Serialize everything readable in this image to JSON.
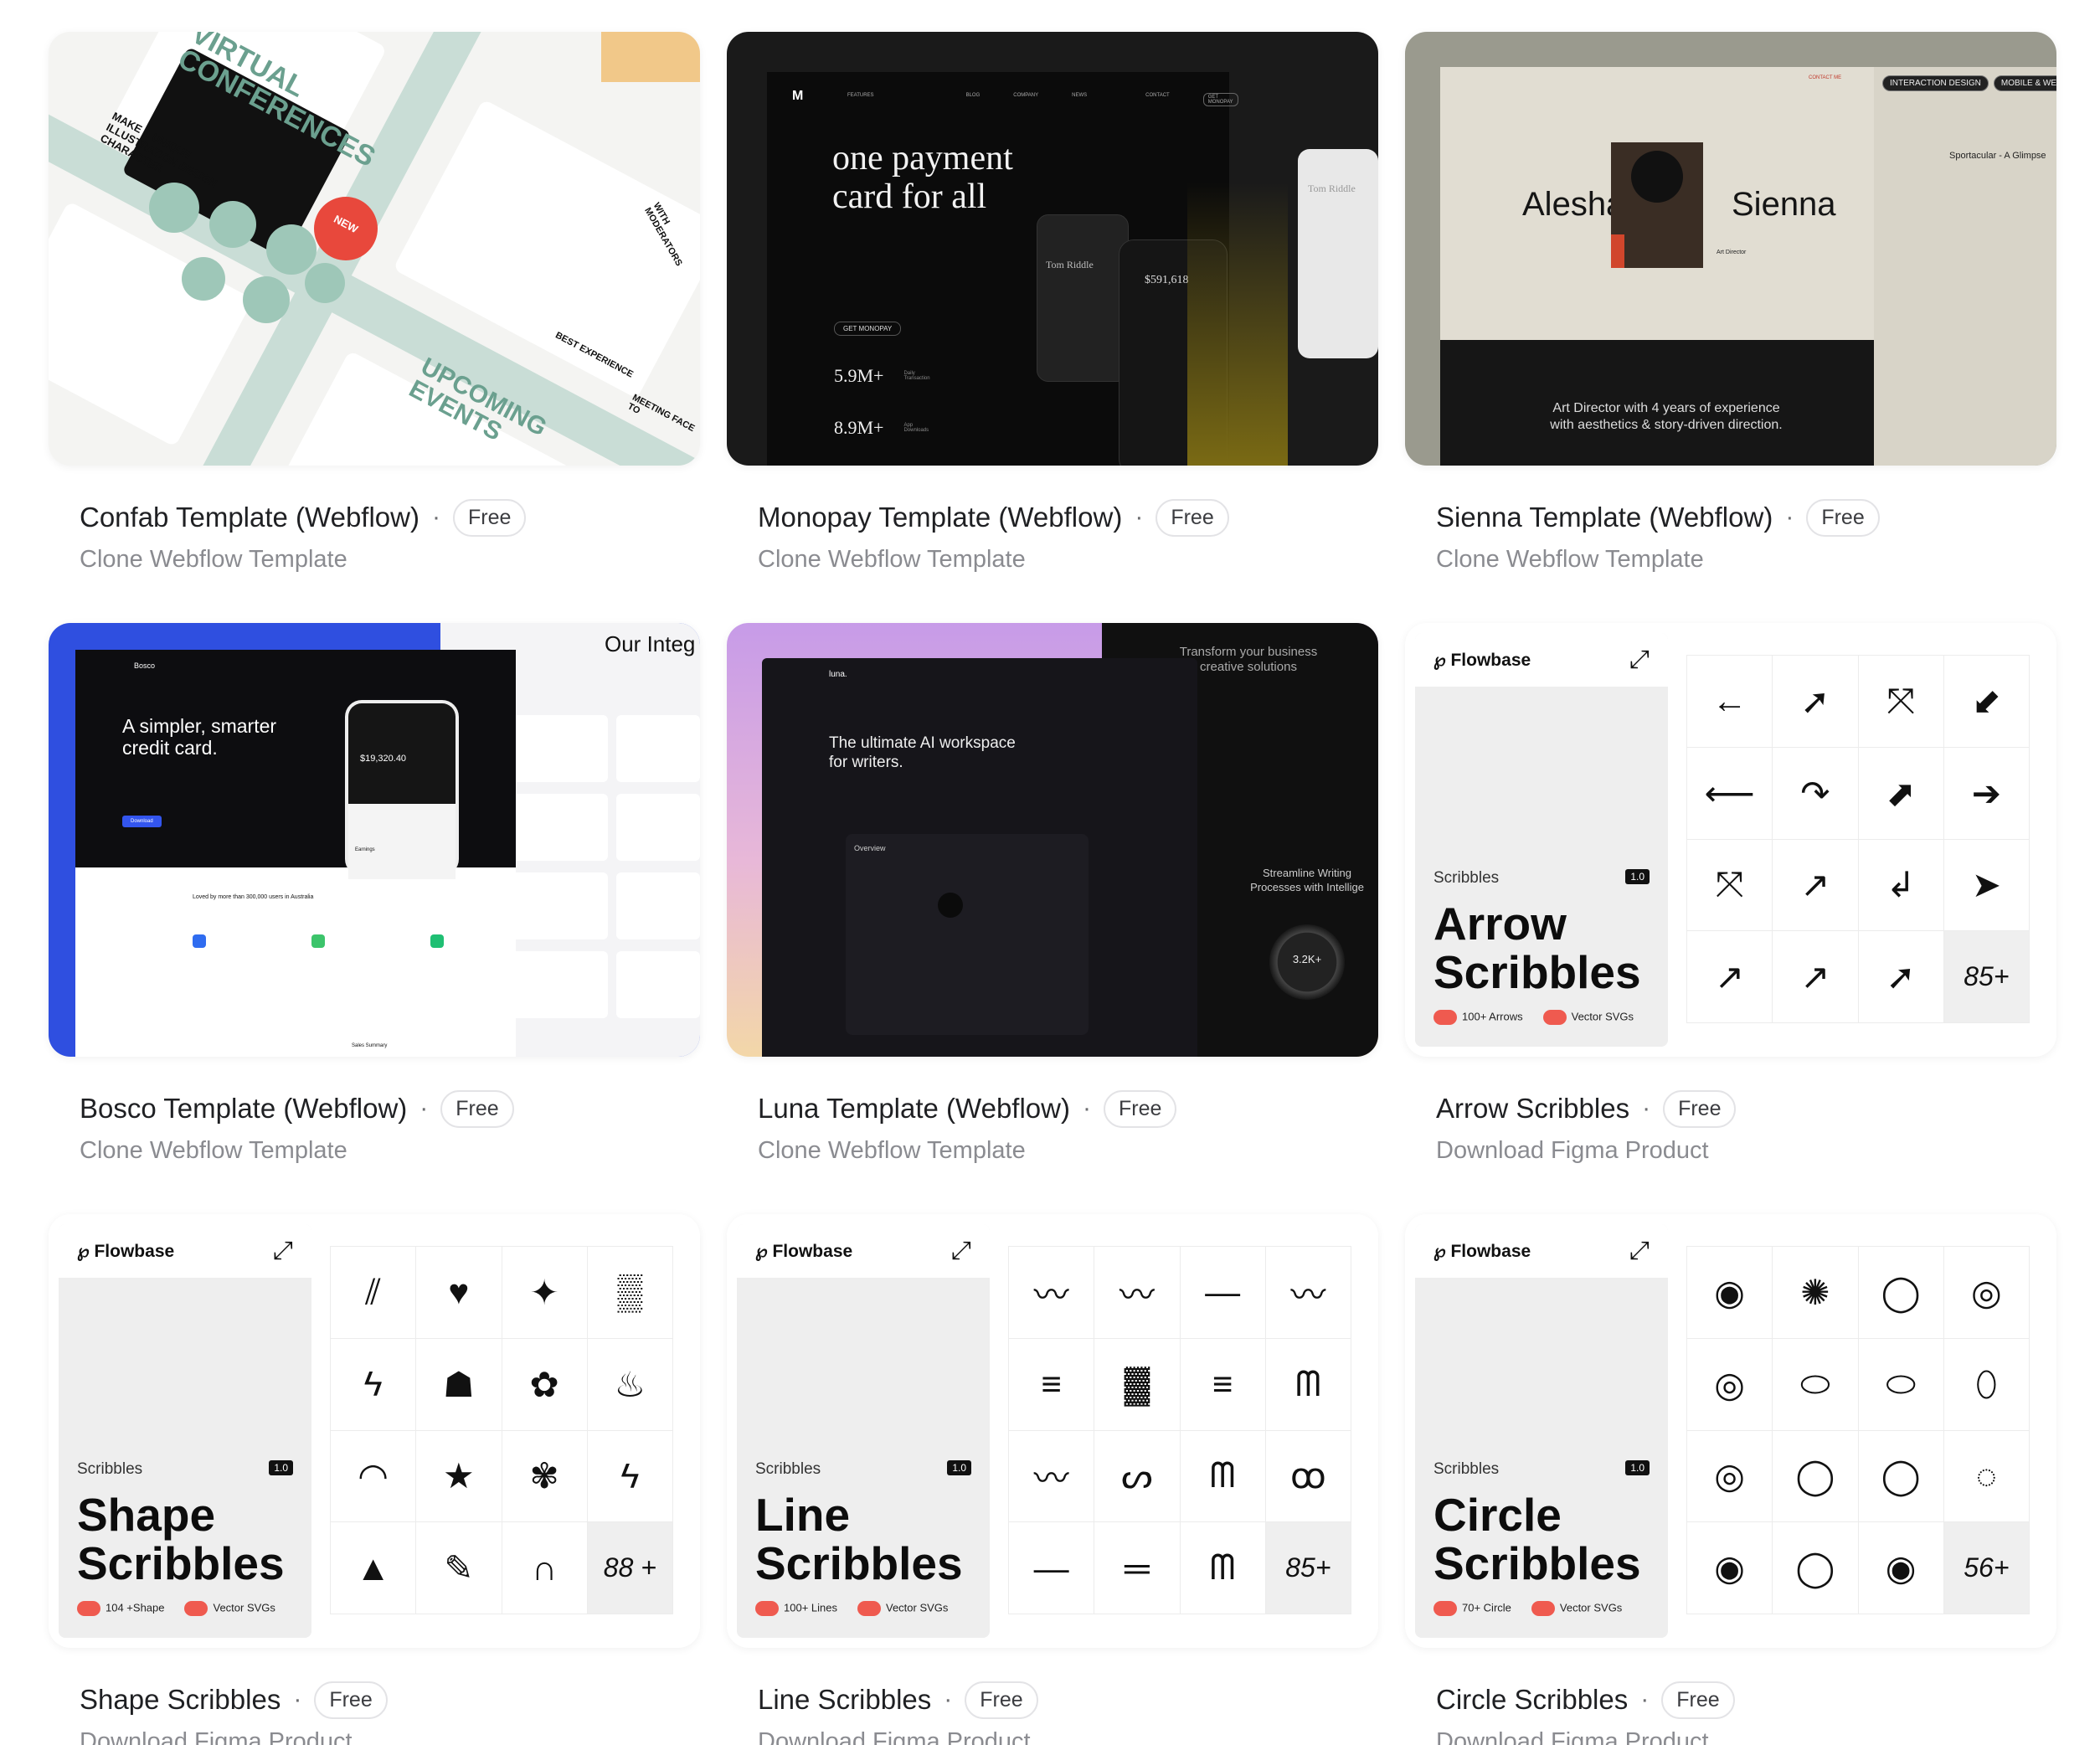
{
  "cards": [
    {
      "title": "Confab Template (Webflow)",
      "badge": "Free",
      "subtitle": "Clone Webflow Template",
      "preview": {
        "headline_1": "VIRTUAL",
        "headline_2": "CONFERENCES",
        "tagline": "MAKE A UNIQUE ILLUSTRATION DESIGN CHARACTER",
        "sticker": "NEW",
        "footer_headline_1": "UPCOMING",
        "footer_headline_2": "EVENTS",
        "side_text_1": "BEST EXPERIENCE",
        "side_text_2": "MEETING FACE TO",
        "side_text_3": "WITH MODERATORS"
      }
    },
    {
      "title": "Monopay Template (Webflow)",
      "badge": "Free",
      "subtitle": "Clone Webflow Template",
      "preview": {
        "headline": "one payment card for all",
        "cta": "GET MONOPAY",
        "stat_1": "5.9M+",
        "stat_1_label": "Daily Transaction",
        "stat_2": "8.9M+",
        "stat_2_label": "App Downloads",
        "card_name": "Tom Riddle",
        "balance": "$591,618",
        "nav_1": "FEATURES",
        "nav_2": "BLOG",
        "nav_3": "COMPANY",
        "nav_4": "NEWS",
        "nav_5": "CONTACT",
        "nav_cta": "GET MONOPAY"
      }
    },
    {
      "title": "Sienna Template (Webflow)",
      "badge": "Free",
      "subtitle": "Clone Webflow Template",
      "preview": {
        "first_name": "Alesha",
        "last_name": "Sienna",
        "bio": "Art Director with 4 years of experience with aesthetics & story-driven direction.",
        "tag_1": "INTERACTION DESIGN",
        "tag_2": "MOBILE & WEB",
        "side_title": "Sportacular - A Glimpse",
        "contact": "CONTACT ME",
        "role": "Art Director"
      }
    },
    {
      "title": "Bosco Template (Webflow)",
      "badge": "Free",
      "subtitle": "Clone Webflow Template",
      "preview": {
        "brand": "Bosco",
        "headline": "A simpler, smarter credit card.",
        "balance": "$19,320.40",
        "loved": "Loved by more than 300,000 users in Australia",
        "side_title": "Our Integ",
        "cta": "Download",
        "earnings": "Earnings",
        "sales": "Sales Summary"
      }
    },
    {
      "title": "Luna Template (Webflow)",
      "badge": "Free",
      "subtitle": "Clone Webflow Template",
      "preview": {
        "brand": "luna.",
        "headline": "The ultimate AI workspace for writers.",
        "overview": "Overview",
        "side_headline": "Transform your business creative solutions",
        "side_text": "Streamline Writing Processes with Intellige",
        "stat": "3.2K+"
      }
    },
    {
      "title": "Arrow Scribbles",
      "badge": "Free",
      "subtitle": "Download Figma Product",
      "preview": {
        "brand": "Flowbase",
        "kicker": "Scribbles",
        "version": "1.0",
        "name_1": "Arrow",
        "name_2": "Scribbles",
        "feature_1": "100+ Arrows",
        "feature_2": "Vector SVGs",
        "more": "85+",
        "glyphs": [
          "←",
          "➚",
          "⤧",
          "⬋",
          "⟵",
          "↷",
          "⬈",
          "➔",
          "⤧",
          "↗",
          "↲",
          "➤",
          "↗",
          "↗",
          "➚"
        ]
      }
    },
    {
      "title": "Shape Scribbles",
      "badge": "Free",
      "subtitle": "Download Figma Product",
      "preview": {
        "brand": "Flowbase",
        "kicker": "Scribbles",
        "version": "1.0",
        "name_1": "Shape",
        "name_2": "Scribbles",
        "feature_1": "104 +Shape",
        "feature_2": "Vector SVGs",
        "more": "88 +",
        "glyphs": [
          "⫽",
          "♥",
          "✦",
          "▒",
          "ϟ",
          "☗",
          "✿",
          "♨",
          "◠",
          "★",
          "✾",
          "ϟ",
          "▲",
          "✎",
          "∩"
        ]
      }
    },
    {
      "title": "Line Scribbles",
      "badge": "Free",
      "subtitle": "Download Figma Product",
      "preview": {
        "brand": "Flowbase",
        "kicker": "Scribbles",
        "version": "1.0",
        "name_1": "Line",
        "name_2": "Scribbles",
        "feature_1": "100+ Lines",
        "feature_2": "Vector SVGs",
        "more": "85+",
        "glyphs": [
          "〰",
          "〰",
          "—",
          "〰",
          "≡",
          "▓",
          "≡",
          "ᗰ",
          "〰",
          "ᔕ",
          "ᗰ",
          "ꝏ",
          "—",
          "═",
          "ᗰ"
        ]
      }
    },
    {
      "title": "Circle Scribbles",
      "badge": "Free",
      "subtitle": "Download Figma Product",
      "preview": {
        "brand": "Flowbase",
        "kicker": "Scribbles",
        "version": "1.0",
        "name_1": "Circle",
        "name_2": "Scribbles",
        "feature_1": "70+ Circle",
        "feature_2": "Vector SVGs",
        "more": "56+",
        "glyphs": [
          "◉",
          "✺",
          "◯",
          "◎",
          "◎",
          "⬭",
          "⬭",
          "⬯",
          "◎",
          "◯",
          "◯",
          "◌",
          "◉",
          "◯",
          "◉"
        ]
      }
    }
  ]
}
